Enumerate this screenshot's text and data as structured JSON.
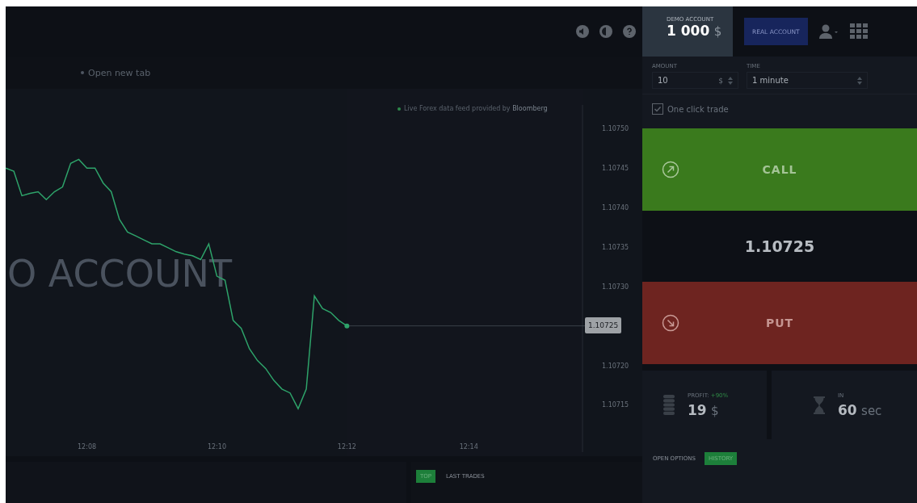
{
  "header": {
    "demo_account": {
      "label": "DEMO ACCOUNT",
      "balance": "1 000",
      "currency": "$",
      "selected": true
    },
    "real_account": {
      "label": "REAL ACCOUNT",
      "selected": false
    }
  },
  "chart": {
    "link": "Open new tab",
    "news": "Live Forex data feed provided by",
    "news_source": "Bloomberg",
    "watermark": "O ACCOUNT",
    "current_price": "1.10725",
    "chart_data": {
      "type": "line",
      "categories": [
        null,
        null,
        null,
        null,
        null,
        null,
        null,
        null,
        null,
        null,
        "12:08",
        null,
        null,
        null,
        null,
        null,
        null,
        null,
        null,
        null,
        null,
        null,
        null,
        null,
        null,
        null,
        "12:10",
        null,
        null,
        null,
        null,
        null,
        null,
        null,
        null,
        null,
        null,
        null,
        null,
        null,
        null,
        null,
        "12:12",
        null,
        null,
        null,
        null,
        null,
        null,
        null,
        null,
        null,
        null,
        null,
        null,
        null,
        null,
        "12:14",
        null,
        null,
        null,
        null,
        null,
        null,
        null,
        null,
        null,
        null,
        null,
        null,
        null,
        null
      ],
      "series": [
        {
          "color": "#2ea36a",
          "values": [
            1.10745,
            1.107446,
            1.107415,
            1.107418,
            1.10742,
            1.10741,
            1.10742,
            1.107426,
            1.107456,
            1.107461,
            1.10745,
            1.10745,
            1.107431,
            1.10742,
            1.107385,
            1.107369,
            1.107364,
            1.107359,
            1.107354,
            1.107354,
            1.107349,
            1.107344,
            1.107341,
            1.107339,
            1.107334,
            1.107354,
            1.107313,
            1.107308,
            1.107257,
            1.107247,
            1.107221,
            1.107206,
            1.107196,
            1.107181,
            1.10717,
            1.107165,
            1.107145,
            1.10717,
            1.107288,
            1.107272,
            1.107267,
            1.107257,
            1.10725,
            null,
            null,
            null,
            null,
            null,
            null,
            null,
            null,
            null,
            null,
            null,
            null,
            null,
            null,
            null,
            null,
            null,
            null,
            null,
            null,
            null,
            null,
            null,
            null,
            null,
            null,
            null,
            null,
            null
          ]
        }
      ],
      "ylim": [
        1.10709,
        1.10753
      ],
      "yticks": [
        {
          "value": 1.1075,
          "label": "1.10750"
        },
        {
          "value": 1.10745,
          "label": "1.10745"
        },
        {
          "value": 1.1074,
          "label": "1.10740"
        },
        {
          "value": 1.10735,
          "label": "1.10735"
        },
        {
          "value": 1.1073,
          "label": "1.10730"
        },
        {
          "value": 1.1072,
          "label": "1.10720"
        },
        {
          "value": 1.10715,
          "label": "1.10715"
        }
      ]
    }
  },
  "trade_panel": {
    "amount": {
      "label": "AMOUNT",
      "value": "10",
      "unit": "$"
    },
    "time": {
      "label": "TIME",
      "value": "1 minute"
    },
    "one_click_trade": {
      "label": "One click trade",
      "checked": true
    },
    "call_button": "CALL",
    "price": "1.10725",
    "put_button": "PUT",
    "profit": {
      "label": "PROFIT:",
      "percent": "+90%",
      "value": "19",
      "unit": "$"
    },
    "expiry": {
      "label": "IN",
      "value": "60",
      "unit": "sec"
    }
  },
  "trades_tabs": [
    {
      "label": "TOP",
      "selected": true
    },
    {
      "label": "LAST TRADES",
      "selected": false
    }
  ],
  "options_tabs": [
    {
      "label": "OPEN OPTIONS",
      "selected": false
    },
    {
      "label": "HISTORY",
      "selected": true
    }
  ]
}
